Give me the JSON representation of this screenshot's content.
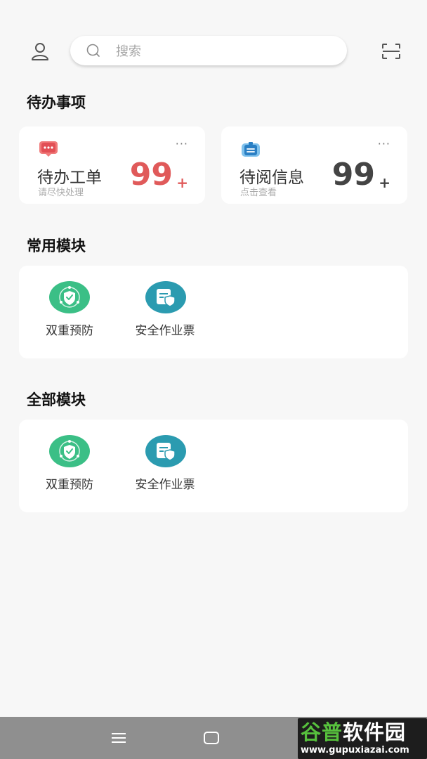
{
  "search": {
    "placeholder": "搜索"
  },
  "sections": {
    "todo": "待办事项",
    "common": "常用模块",
    "all": "全部模块"
  },
  "todo_cards": [
    {
      "label": "待办工单",
      "sub": "请尽快处理",
      "count": "99",
      "plus": "+",
      "more": "···",
      "color": "#e05a5a",
      "icon": "message-icon"
    },
    {
      "label": "待阅信息",
      "sub": "点击查看",
      "count": "99",
      "plus": "+",
      "more": "···",
      "color": "#444444",
      "icon": "notice-board-icon"
    }
  ],
  "common_modules": [
    {
      "label": "双重预防",
      "icon": "shield-check-icon",
      "color": "#3bbf86"
    },
    {
      "label": "安全作业票",
      "icon": "ticket-shield-icon",
      "color": "#2b9bb0"
    }
  ],
  "all_modules": [
    {
      "label": "双重预防",
      "icon": "shield-check-icon",
      "color": "#3bbf86"
    },
    {
      "label": "安全作业票",
      "icon": "ticket-shield-icon",
      "color": "#2b9bb0"
    }
  ],
  "watermark": {
    "title_a": "谷普",
    "title_b": "软件园",
    "url": "www.gupuxiazai.com"
  }
}
